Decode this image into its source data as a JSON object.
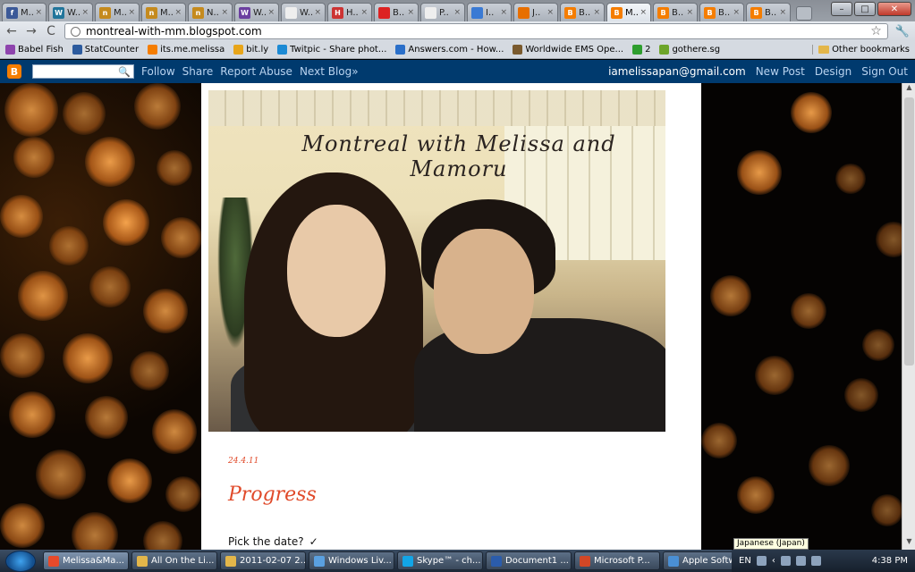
{
  "browser": {
    "tabs": [
      {
        "label": "M..",
        "icon": "facebook-icon",
        "color": "#3b5998",
        "glyph": "f"
      },
      {
        "label": "W..",
        "icon": "wordpress-icon",
        "color": "#21759b",
        "glyph": "W"
      },
      {
        "label": "M..",
        "icon": "n-icon",
        "color": "#c58a1d",
        "glyph": "n"
      },
      {
        "label": "M..",
        "icon": "n-icon",
        "color": "#c58a1d",
        "glyph": "n"
      },
      {
        "label": "N..",
        "icon": "n-icon",
        "color": "#c58a1d",
        "glyph": "n"
      },
      {
        "label": "W..",
        "icon": "app-icon",
        "color": "#6b3fa0",
        "glyph": "W"
      },
      {
        "label": "W..",
        "icon": "page-icon",
        "color": "#eeeeee",
        "glyph": ""
      },
      {
        "label": "H..",
        "icon": "grid-icon",
        "color": "#cc3333",
        "glyph": "H"
      },
      {
        "label": "B..",
        "icon": "red-dot-icon",
        "color": "#dd2222",
        "glyph": ""
      },
      {
        "label": "P..",
        "icon": "page-icon",
        "color": "#eeeeee",
        "glyph": ""
      },
      {
        "label": "I..",
        "icon": "window-icon",
        "color": "#3a7ad4",
        "glyph": ""
      },
      {
        "label": "J..",
        "icon": "java-icon",
        "color": "#e76f00",
        "glyph": ""
      },
      {
        "label": "B..",
        "icon": "blogger-icon",
        "color": "#f57d00",
        "glyph": "B"
      },
      {
        "label": "M..",
        "icon": "blogger-icon",
        "color": "#f57d00",
        "glyph": "B",
        "active": true
      },
      {
        "label": "B..",
        "icon": "blogger-icon",
        "color": "#f57d00",
        "glyph": "B"
      },
      {
        "label": "B..",
        "icon": "blogger-icon",
        "color": "#f57d00",
        "glyph": "B"
      },
      {
        "label": "B..",
        "icon": "blogger-icon",
        "color": "#f57d00",
        "glyph": "B"
      }
    ],
    "url": "montreal-with-mm.blogspot.com",
    "bookmarks": [
      {
        "label": "Babel Fish",
        "icon": "babelfish-icon",
        "color": "#8e44ad"
      },
      {
        "label": "StatCounter",
        "icon": "statcounter-icon",
        "color": "#2c5b9e"
      },
      {
        "label": "its.me.melissa",
        "icon": "blogger-icon",
        "color": "#f57d00"
      },
      {
        "label": "bit.ly",
        "icon": "bitly-icon",
        "color": "#e8a51a"
      },
      {
        "label": "Twitpic - Share phot...",
        "icon": "twitpic-icon",
        "color": "#1c8ad4"
      },
      {
        "label": "Answers.com - How...",
        "icon": "answers-icon",
        "color": "#2a6fc9"
      },
      {
        "label": "Worldwide EMS Ope...",
        "icon": "ems-icon",
        "color": "#7a5a2e"
      },
      {
        "label": "2",
        "icon": "leaf-icon",
        "color": "#2e9e2e"
      },
      {
        "label": "gothere.sg",
        "icon": "gothere-icon",
        "color": "#6da52a"
      }
    ],
    "other_bookmarks": "Other bookmarks"
  },
  "blogger_nav": {
    "search_glyph": "🔍",
    "links": [
      "Follow",
      "Share",
      "Report Abuse",
      "Next Blog»"
    ],
    "email": "iamelissapan@gmail.com",
    "right_links": [
      "New Post",
      "Design",
      "Sign Out"
    ]
  },
  "blog": {
    "title": "Montreal with Melissa and Mamoru",
    "post": {
      "date": "24.4.11",
      "title": "Progress",
      "text": "Pick the date?",
      "check": "✓"
    }
  },
  "ime_tooltip": "Japanese (Japan)",
  "taskbar": {
    "tasks": [
      {
        "label": "Melissa&Ma...",
        "color": "#e84a2a",
        "active": true
      },
      {
        "label": "All On the Li...",
        "color": "#e3b64a"
      },
      {
        "label": "2011-02-07 2...",
        "color": "#e3b64a"
      },
      {
        "label": "Windows Liv...",
        "color": "#5aa0e0"
      },
      {
        "label": "Skype™ - ch...",
        "color": "#12a5e6"
      },
      {
        "label": "Document1 ...",
        "color": "#2b5cab"
      },
      {
        "label": "Microsoft P...",
        "color": "#d24726"
      },
      {
        "label": "Apple Softw...",
        "color": "#4a8fd4"
      }
    ],
    "tray_lang": "EN",
    "clock": "4:38 PM"
  }
}
